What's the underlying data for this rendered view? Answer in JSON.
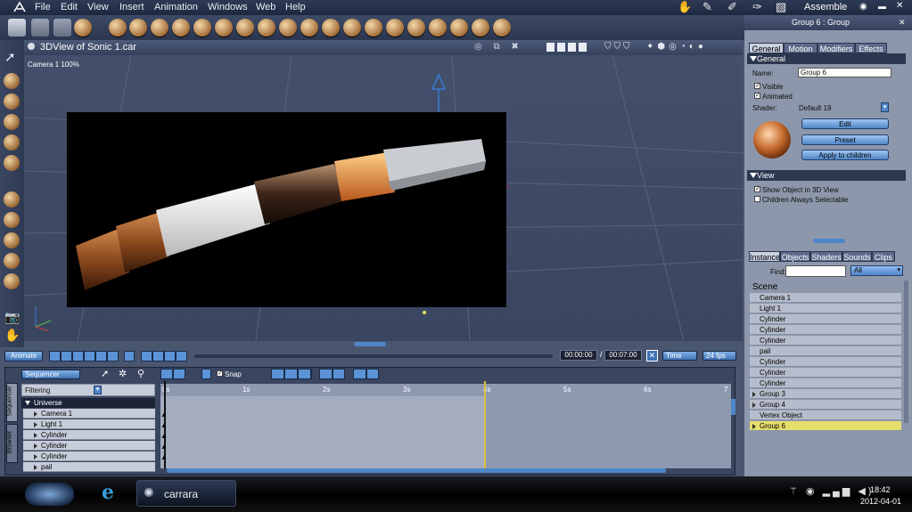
{
  "menu": [
    "File",
    "Edit",
    "View",
    "Insert",
    "Animation",
    "Windows",
    "Web",
    "Help"
  ],
  "room": "Assemble",
  "view3d": {
    "title": "3DView of Sonic 1.car",
    "camera": "Camera 1 100%"
  },
  "panel": {
    "title": "Group 6 : Group",
    "tabs": [
      "General",
      "Motion",
      "Modifiers",
      "Effects"
    ],
    "section_general": "General",
    "name_label": "Name:",
    "name_value": "Group 6",
    "visible": "Visible",
    "animated": "Animated",
    "shader_label": "Shader:",
    "shader_value": "Default 19",
    "edit": "Edit",
    "preset": "Preset",
    "apply": "Apply to children",
    "section_view": "View",
    "show_obj": "Show Object in 3D View",
    "children_sel": "Children Always Selectable"
  },
  "browser": {
    "tabs": [
      "Instance",
      "Objects",
      "Shaders",
      "Sounds",
      "Clips"
    ],
    "find_label": "Find:",
    "find_value": "",
    "filter": "All",
    "scene_title": "Scene",
    "items": [
      {
        "label": "Camera 1",
        "arrow": false
      },
      {
        "label": "Light 1",
        "arrow": false
      },
      {
        "label": "Cylinder",
        "arrow": false
      },
      {
        "label": "Cylinder",
        "arrow": false
      },
      {
        "label": "Cylinder",
        "arrow": false
      },
      {
        "label": "pail",
        "arrow": false
      },
      {
        "label": "Cylinder",
        "arrow": false
      },
      {
        "label": "Cylinder",
        "arrow": false
      },
      {
        "label": "Cylinder",
        "arrow": false
      },
      {
        "label": "Group 3",
        "arrow": true
      },
      {
        "label": "Group 4",
        "arrow": true
      },
      {
        "label": "Vertex Object",
        "arrow": false
      },
      {
        "label": "Group 6",
        "arrow": true
      }
    ]
  },
  "timeline": {
    "animate": "Animate",
    "time_current": "00:00:00",
    "time_end": "00:07:00",
    "time_mode": "Time",
    "fps": "24 fps",
    "sequencer": "Sequencer",
    "snap": "Snap",
    "filtering": "Filtering",
    "side_tab_1": "Sequencer",
    "side_tab_2": "Browser",
    "universe": "Universe",
    "rows": [
      "Camera 1",
      "Light 1",
      "Cylinder",
      "Cylinder",
      "Cylinder",
      "pail"
    ],
    "ruler": [
      "0s",
      "1s",
      "2s",
      "3s",
      "4s",
      "5s",
      "6s",
      "7"
    ]
  },
  "taskbar": {
    "app": "carrara",
    "time": "18:42",
    "date": "2012-04-01"
  }
}
